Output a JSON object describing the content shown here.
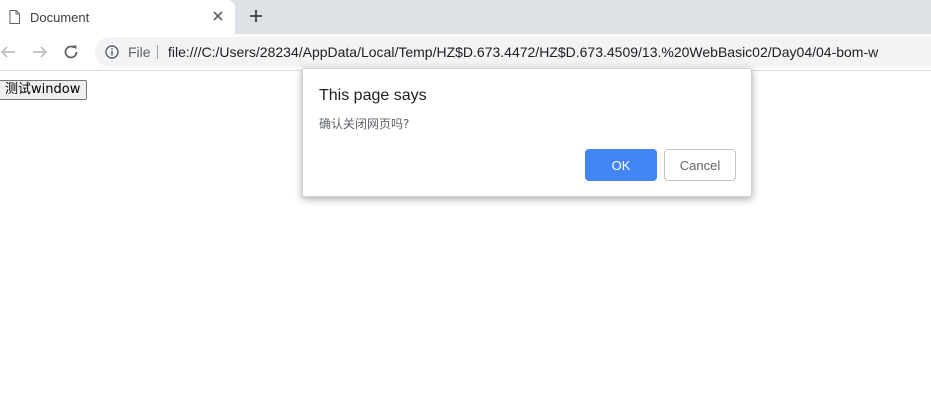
{
  "browser": {
    "tab": {
      "title": "Document",
      "favicon": "document-icon",
      "close_icon": "close-icon"
    },
    "new_tab_icon": "plus-icon",
    "toolbar": {
      "back_icon": "arrow-left-icon",
      "forward_icon": "arrow-right-icon",
      "reload_icon": "reload-icon",
      "info_icon": "info-icon",
      "scheme_label": "File",
      "url": "file:///C:/Users/28234/AppData/Local/Temp/HZ$D.673.4472/HZ$D.673.4509/13.%20WebBasic02/Day04/04-bom-w"
    }
  },
  "page": {
    "test_button_label": "测试window"
  },
  "dialog": {
    "title": "This page says",
    "message": "确认关闭网页吗?",
    "ok_label": "OK",
    "cancel_label": "Cancel"
  },
  "colors": {
    "tabstrip_bg": "#dee1e6",
    "ok_button_bg": "#4285f4",
    "omnibox_bg": "#f1f3f4"
  }
}
